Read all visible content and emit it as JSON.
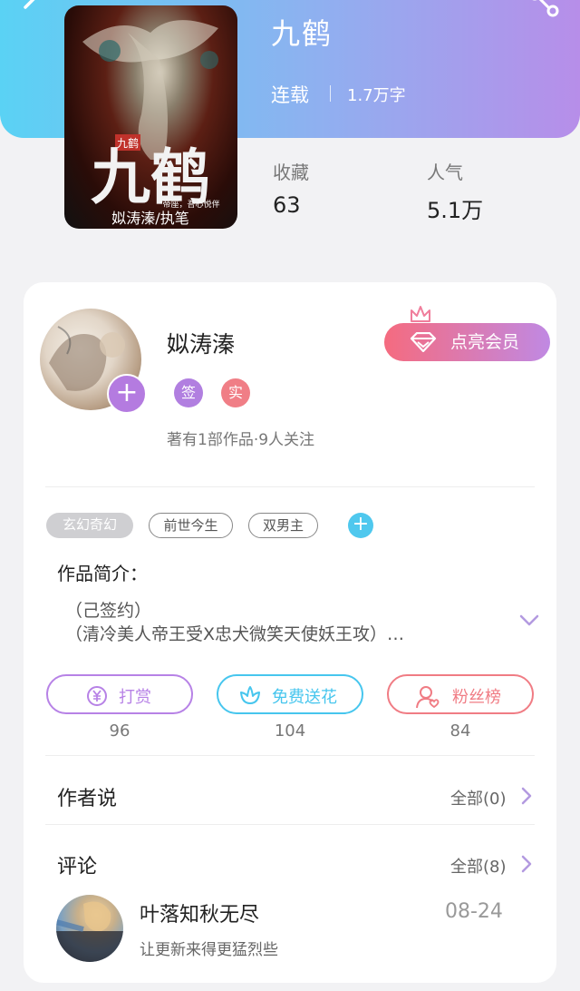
{
  "book": {
    "title": "九鹤",
    "status": "连载",
    "word_count": "1.7万字",
    "cover_text": {
      "badge": "九鹤",
      "big_title": "九鹤",
      "author_line": "姒涛溱/执笔",
      "tagline": "帝座，吾心悦伴"
    }
  },
  "stats": [
    {
      "label": "收藏",
      "value": "63"
    },
    {
      "label": "人气",
      "value": "5.1万"
    }
  ],
  "author": {
    "name": "姒涛溱",
    "badges": [
      {
        "text": "签",
        "color": "#b17fe0"
      },
      {
        "text": "实",
        "color": "#f07e86"
      }
    ],
    "meta": "著有1部作品·9人关注",
    "vip_button": "点亮会员"
  },
  "tags": [
    "玄幻奇幻",
    "前世今生",
    "双男主"
  ],
  "intro": {
    "label": "作品简介：",
    "lines": [
      "（己签约）",
      "（清冷美人帝王受X忠犬微笑天使妖王攻）…"
    ]
  },
  "actions": [
    {
      "label": "打赏",
      "count": "96",
      "icon": "yuan-coin-icon",
      "color": "#b782e6"
    },
    {
      "label": "免费送花",
      "count": "104",
      "icon": "flower-icon",
      "color": "#47c6ee"
    },
    {
      "label": "粉丝榜",
      "count": "84",
      "icon": "fan-user-icon",
      "color": "#f07c84"
    }
  ],
  "author_says": {
    "title": "作者说",
    "link": "全部(0)"
  },
  "comments": {
    "title": "评论",
    "link": "全部(8)",
    "items": [
      {
        "user": "叶落知秋无尽",
        "date": "08-24",
        "text": "让更新来得更猛烈些"
      }
    ]
  }
}
